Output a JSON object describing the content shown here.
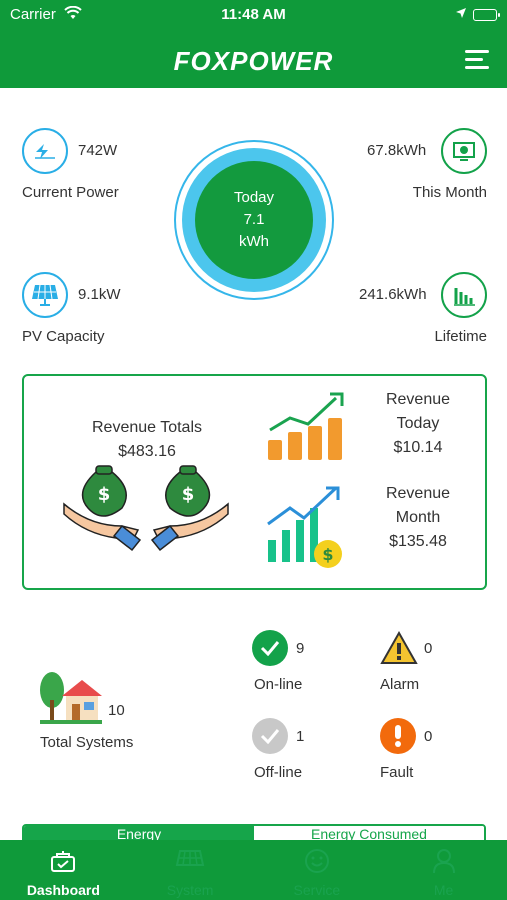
{
  "status_bar": {
    "carrier": "Carrier",
    "time": "11:48 AM"
  },
  "header": {
    "brand": "FOXPOWER"
  },
  "metrics": {
    "current_power": {
      "value": "742W",
      "label": "Current Power"
    },
    "this_month": {
      "value": "67.8kWh",
      "label": "This Month"
    },
    "pv_capacity": {
      "value": "9.1kW",
      "label": "PV Capacity"
    },
    "lifetime": {
      "value": "241.6kWh",
      "label": "Lifetime"
    },
    "today": {
      "label": "Today",
      "value": "7.1",
      "unit": "kWh"
    }
  },
  "revenue": {
    "totals_label": "Revenue Totals",
    "totals_value": "$483.16",
    "today_label_1": "Revenue",
    "today_label_2": "Today",
    "today_value": "$10.14",
    "month_label_1": "Revenue",
    "month_label_2": "Month",
    "month_value": "$135.48"
  },
  "systems": {
    "total_label": "Total Systems",
    "total_value": "10",
    "online_label": "On-line",
    "online_value": "9",
    "alarm_label": "Alarm",
    "alarm_value": "0",
    "offline_label": "Off-line",
    "offline_value": "1",
    "fault_label": "Fault",
    "fault_value": "0"
  },
  "segment": {
    "tab1": "Energy",
    "tab2": "Energy Consumed"
  },
  "tabbar": {
    "dashboard": "Dashboard",
    "system": "System",
    "service": "Service",
    "me": "Me"
  },
  "colors": {
    "primary": "#0f9a3a",
    "ring": "#4cc6ed",
    "alarm": "#f4b400",
    "fault": "#f26a0c"
  }
}
